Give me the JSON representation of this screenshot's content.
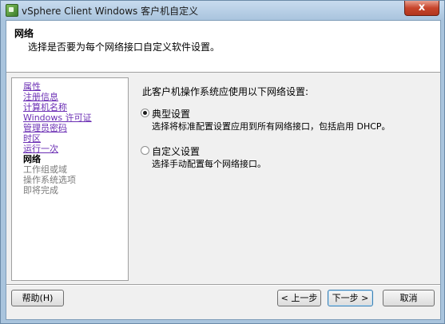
{
  "window": {
    "title": "vSphere Client Windows 客户机自定义",
    "close_glyph": "x"
  },
  "header": {
    "title": "网络",
    "subtitle": "选择是否要为每个网络接口自定义软件设置。"
  },
  "sidebar": {
    "items": [
      {
        "label": "属性",
        "state": "link"
      },
      {
        "label": "注册信息",
        "state": "link"
      },
      {
        "label": "计算机名称",
        "state": "link"
      },
      {
        "label": "Windows 许可证",
        "state": "link"
      },
      {
        "label": "管理员密码",
        "state": "link"
      },
      {
        "label": "时区",
        "state": "link"
      },
      {
        "label": "运行一次",
        "state": "link"
      },
      {
        "label": "网络",
        "state": "current"
      },
      {
        "label": "工作组或域",
        "state": "disabled"
      },
      {
        "label": "操作系统选项",
        "state": "disabled"
      },
      {
        "label": "即将完成",
        "state": "disabled"
      }
    ]
  },
  "main": {
    "question": "此客户机操作系统应使用以下网络设置:",
    "options": [
      {
        "label": "典型设置",
        "description": "选择将标准配置设置应用到所有网络接口，包括启用 DHCP。",
        "selected": true
      },
      {
        "label": "自定义设置",
        "description": "选择手动配置每个网络接口。",
        "selected": false
      }
    ]
  },
  "footer": {
    "help_label": "帮助(H)",
    "back_label": "< 上一步",
    "next_label": "下一步 >",
    "cancel_label": "取消"
  },
  "colors": {
    "window_frame": "#a9c4dd",
    "link": "#6b2fb4",
    "close_button": "#c7452b"
  },
  "icons": {
    "app": "vsphere-app-icon",
    "close": "close-icon"
  }
}
